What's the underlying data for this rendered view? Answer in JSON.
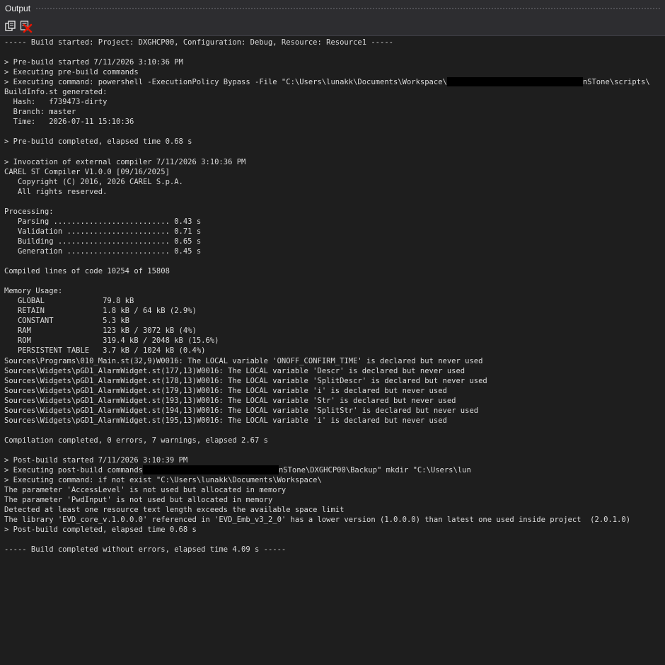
{
  "window": {
    "title": "Output"
  },
  "toolbar": {
    "copy_icon": "copy-icon",
    "clear_icon": "clear-all-icon",
    "clear_color": "#e51400"
  },
  "theme": {
    "background": "#1e1e1e",
    "chrome": "#2d2d30",
    "text": "#dcdcdc",
    "redaction": "#000000"
  },
  "log": {
    "lines": [
      "----- Build started: Project: DXGHCP00, Configuration: Debug, Resource: Resource1 -----",
      "",
      "> Pre-build started 7/11/2026 3:10:36 PM",
      "> Executing pre-build commands",
      "> Executing command: powershell -ExecutionPolicy Bypass -File \"C:\\Users\\lunakk\\Documents\\Workspace\\",
      "BuildInfo.st generated:",
      "  Hash:   f739473-dirty",
      "  Branch: master",
      "  Time:   2026-07-11 15:10:36",
      "",
      "> Pre-build completed, elapsed time 0.68 s",
      "",
      "> Invocation of external compiler 7/11/2026 3:10:36 PM",
      "CAREL ST Compiler V1.0.0 [09/16/2025]",
      "   Copyright (C) 2016, 2026 CAREL S.p.A.",
      "   All rights reserved.",
      "",
      "Processing:",
      "   Parsing .......................... 0.43 s",
      "   Validation ....................... 0.71 s",
      "   Building ......................... 0.65 s",
      "   Generation ....................... 0.45 s",
      "",
      "Compiled lines of code 10254 of 15808",
      "",
      "Memory Usage:",
      "   GLOBAL             79.8 kB",
      "   RETAIN             1.8 kB / 64 kB (2.9%)",
      "   CONSTANT           5.3 kB",
      "   RAM                123 kB / 3072 kB (4%)",
      "   ROM                319.4 kB / 2048 kB (15.6%)",
      "   PERSISTENT TABLE   3.7 kB / 1024 kB (0.4%)",
      "Sources\\Programs\\010_Main.st(32,9)W0016: The LOCAL variable 'ONOFF_CONFIRM_TIME' is declared but never used",
      "Sources\\Widgets\\pGD1_AlarmWidget.st(177,13)W0016: The LOCAL variable 'Descr' is declared but never used",
      "Sources\\Widgets\\pGD1_AlarmWidget.st(178,13)W0016: The LOCAL variable 'SplitDescr' is declared but never used",
      "Sources\\Widgets\\pGD1_AlarmWidget.st(179,13)W0016: The LOCAL variable 'i' is declared but never used",
      "Sources\\Widgets\\pGD1_AlarmWidget.st(193,13)W0016: The LOCAL variable 'Str' is declared but never used",
      "Sources\\Widgets\\pGD1_AlarmWidget.st(194,13)W0016: The LOCAL variable 'SplitStr' is declared but never used",
      "Sources\\Widgets\\pGD1_AlarmWidget.st(195,13)W0016: The LOCAL variable 'i' is declared but never used",
      "",
      "Compilation completed, 0 errors, 7 warnings, elapsed 2.67 s",
      "",
      "> Post-build started 7/11/2026 3:10:39 PM",
      "> Executing post-build commands",
      "> Executing command: if not exist \"C:\\Users\\lunakk\\Documents\\Workspace\\",
      "The parameter 'AccessLevel' is not used but allocated in memory",
      "The parameter 'PwdInput' is not used but allocated in memory",
      "Detected at least one resource text length exceeds the available space limit",
      "The library 'EVD_core_v.1.0.0.0' referenced in 'EVD_Emb_v3_2_0' has a lower version (1.0.0.0) than latest one used inside project  (2.0.1.0)",
      "> Post-build completed, elapsed time 0.68 s",
      "",
      "----- Build completed without errors, elapsed time 4.09 s -----"
    ],
    "line_tails": {
      "4": "nSTone\\scripts\\",
      "43": "nSTone\\DXGHCP00\\Backup\" mkdir \"C:\\Users\\lun"
    }
  }
}
